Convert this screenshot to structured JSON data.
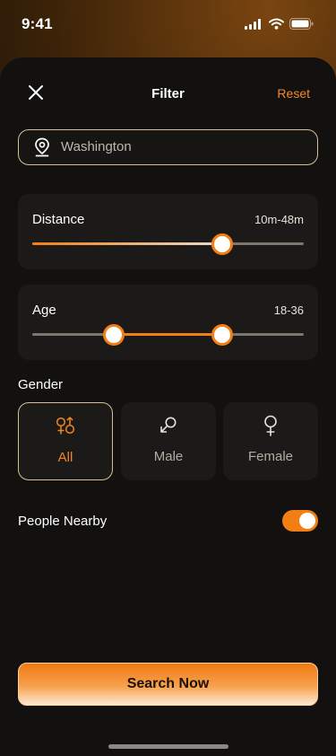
{
  "status_bar": {
    "time": "9:41"
  },
  "header": {
    "title": "Filter",
    "reset_label": "Reset",
    "close_icon": "close-icon"
  },
  "location": {
    "value": "Washington",
    "icon": "map-pin-icon"
  },
  "distance": {
    "label": "Distance",
    "value": "10m-48m",
    "level": 0.7
  },
  "age": {
    "label": "Age",
    "value": "18-36",
    "range_start": 0.3,
    "range_end": 0.7
  },
  "gender": {
    "label": "Gender",
    "options": [
      {
        "label": "All",
        "icon": "all-genders-icon",
        "selected": true
      },
      {
        "label": "Male",
        "icon": "male-icon",
        "selected": false
      },
      {
        "label": "Female",
        "icon": "female-icon",
        "selected": false
      }
    ]
  },
  "people_nearby": {
    "label": "People Nearby",
    "enabled": true
  },
  "search_button": {
    "label": "Search Now"
  },
  "colors": {
    "accent": "#f27e14",
    "border": "#d6bf95",
    "card": "#1c1a18",
    "background": "#121110"
  }
}
